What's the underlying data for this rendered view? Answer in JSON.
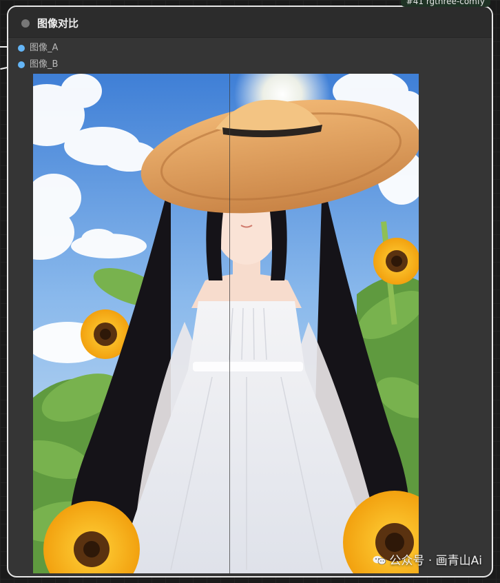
{
  "node": {
    "id_badge": "#41 rgthree-comfy",
    "title": "图像对比",
    "inputs": [
      {
        "label": "图像_A"
      },
      {
        "label": "图像_B"
      }
    ]
  },
  "image": {
    "description_icon": "image-preview"
  },
  "watermark": {
    "text": "公众号 · 画青山Ai"
  },
  "colors": {
    "node_bg": "#353535",
    "slot_color": "#64b5f6",
    "border": "#e8e8e8"
  }
}
